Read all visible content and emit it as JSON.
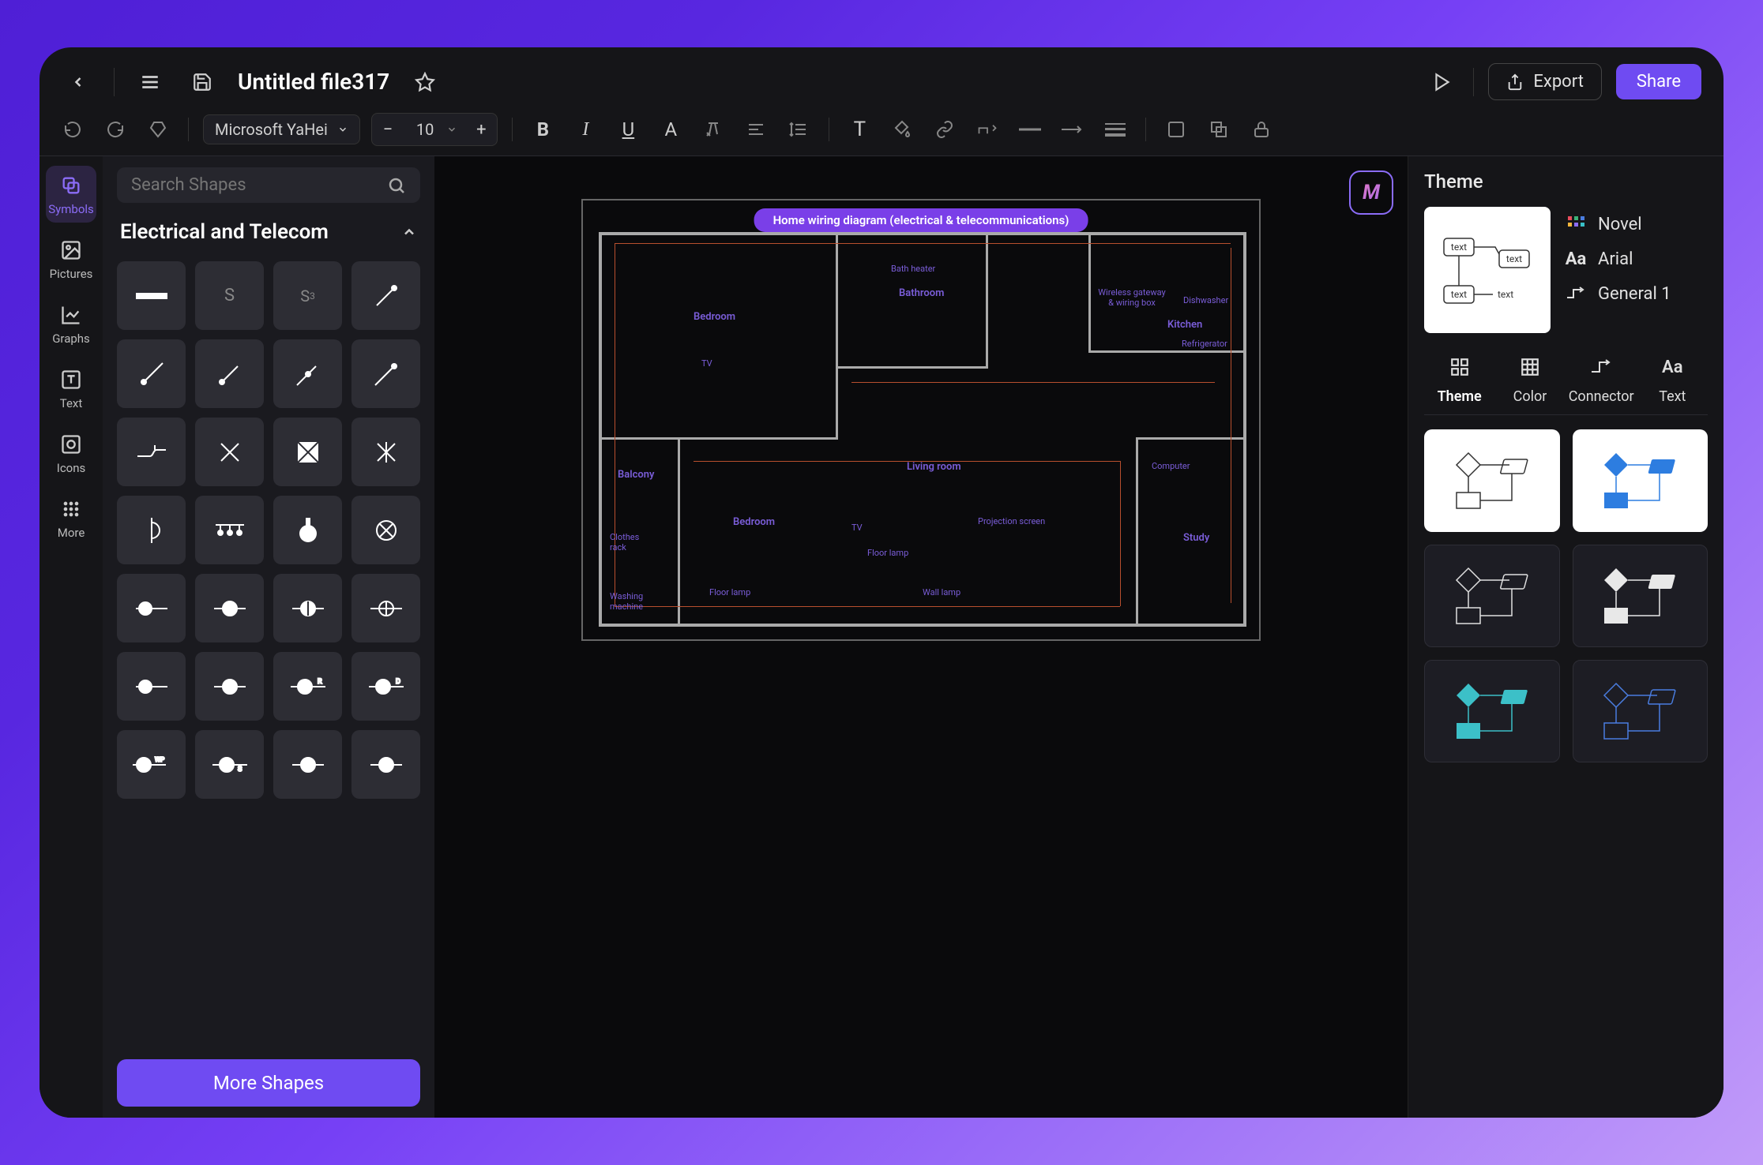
{
  "header": {
    "file_title": "Untitled file317",
    "export_label": "Export",
    "share_label": "Share"
  },
  "toolbar": {
    "font_family": "Microsoft YaHei",
    "font_size": "10"
  },
  "siderail": {
    "items": [
      {
        "label": "Symbols"
      },
      {
        "label": "Pictures"
      },
      {
        "label": "Graphs"
      },
      {
        "label": "Text"
      },
      {
        "label": "Icons"
      },
      {
        "label": "More"
      }
    ]
  },
  "shapes_panel": {
    "search_placeholder": "Search Shapes",
    "section_title": "Electrical and Telecom",
    "more_shapes_label": "More Shapes"
  },
  "canvas": {
    "diagram_title": "Home wiring diagram (electrical & telecommunications)",
    "rooms": {
      "bedroom1": "Bedroom",
      "bedroom2": "Bedroom",
      "bathroom": "Bathroom",
      "kitchen": "Kitchen",
      "living_room": "Living room",
      "balcony": "Balcony",
      "study": "Study"
    },
    "annotations": {
      "bath_heater": "Bath heater",
      "wireless_gateway": "Wireless gateway & wiring box",
      "dishwasher": "Dishwasher",
      "refrigerator": "Refrigerator",
      "tv1": "TV",
      "tv2": "TV",
      "computer": "Computer",
      "projection": "Projection screen",
      "floor_lamp1": "Floor lamp",
      "floor_lamp2": "Floor lamp",
      "wall_lamp": "Wall lamp",
      "clothes_rack": "Clothes rack",
      "washing_machine": "Washing machine"
    }
  },
  "theme_panel": {
    "title": "Theme",
    "name": "Novel",
    "font": "Arial",
    "connector": "General 1",
    "tabs": [
      {
        "label": "Theme"
      },
      {
        "label": "Color"
      },
      {
        "label": "Connector"
      },
      {
        "label": "Text"
      }
    ],
    "preview_text": "text"
  }
}
